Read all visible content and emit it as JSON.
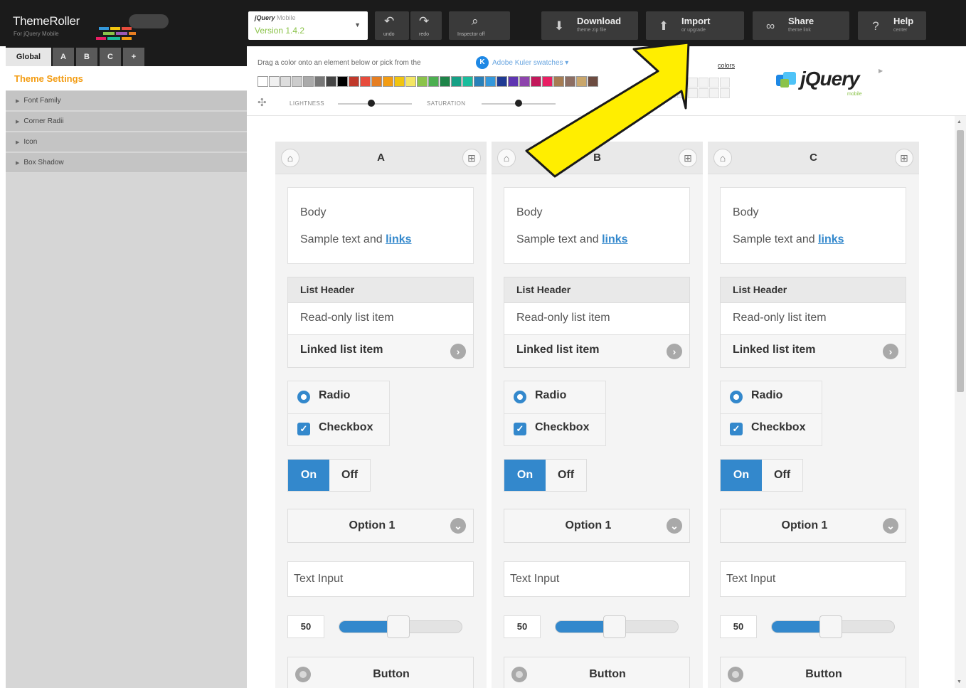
{
  "app": {
    "title": "ThemeRoller",
    "subtitle": "For jQuery Mobile"
  },
  "version": {
    "product": "jQuery",
    "product_suffix": "Mobile",
    "label": "Version 1.4.2"
  },
  "toolbar": {
    "undo_label": "undo",
    "redo_label": "redo",
    "inspector_label": "Inspector off",
    "download_title": "Download",
    "download_sub": "theme zip file",
    "import_title": "Import",
    "import_sub": "or upgrade",
    "share_title": "Share",
    "share_sub": "theme link",
    "help_title": "Help",
    "help_sub": "center"
  },
  "left": {
    "tabs": [
      "Global",
      "A",
      "B",
      "C",
      "+"
    ],
    "section_title": "Theme Settings",
    "accordion": [
      "Font Family",
      "Corner Radii",
      "Icon",
      "Box Shadow"
    ]
  },
  "colors": {
    "drag_text": "Drag a color onto an element below or pick from the",
    "kuler_link": "Adobe Kuler swatches ▾",
    "colors_link": "colors",
    "lightness_label": "LIGHTNESS",
    "saturation_label": "SATURATION",
    "lightness_level": 0.45,
    "saturation_level": 0.5,
    "swatches": [
      "#ffffff",
      "#f0f0f0",
      "#dddddd",
      "#cccccc",
      "#aaaaaa",
      "#777777",
      "#444444",
      "#000000",
      "#c0392b",
      "#e74c3c",
      "#e67e22",
      "#f39c12",
      "#f1c40f",
      "#f5e663",
      "#8bc34a",
      "#4caf50",
      "#1e8449",
      "#16a085",
      "#1abc9c",
      "#2980b9",
      "#3498db",
      "#1f3a93",
      "#5e35b1",
      "#8e44ad",
      "#c2185b",
      "#e91e63",
      "#a67c52",
      "#8d6e63",
      "#c9a66b",
      "#6d4c41"
    ],
    "accent": "#3388cc"
  },
  "brand": {
    "name": "jQuery",
    "sub": "mobile"
  },
  "swatches": [
    {
      "letter": "A",
      "body": "Body",
      "sample_prefix": "Sample text and",
      "sample_link": "links",
      "list_header": "List Header",
      "readonly": "Read-only list item",
      "linked": "Linked list item",
      "radio": "Radio",
      "checkbox": "Checkbox",
      "on": "On",
      "off": "Off",
      "select_value": "Option 1",
      "input_placeholder": "Text Input",
      "slider_value": "50",
      "button": "Button"
    },
    {
      "letter": "B",
      "body": "Body",
      "sample_prefix": "Sample text and",
      "sample_link": "links",
      "list_header": "List Header",
      "readonly": "Read-only list item",
      "linked": "Linked list item",
      "radio": "Radio",
      "checkbox": "Checkbox",
      "on": "On",
      "off": "Off",
      "select_value": "Option 1",
      "input_placeholder": "Text Input",
      "slider_value": "50",
      "button": "Button"
    },
    {
      "letter": "C",
      "body": "Body",
      "sample_prefix": "Sample text and",
      "sample_link": "links",
      "list_header": "List Header",
      "readonly": "Read-only list item",
      "linked": "Linked list item",
      "radio": "Radio",
      "checkbox": "Checkbox",
      "on": "On",
      "off": "Off",
      "select_value": "Option 1",
      "input_placeholder": "Text Input",
      "slider_value": "50",
      "button": "Button"
    }
  ]
}
